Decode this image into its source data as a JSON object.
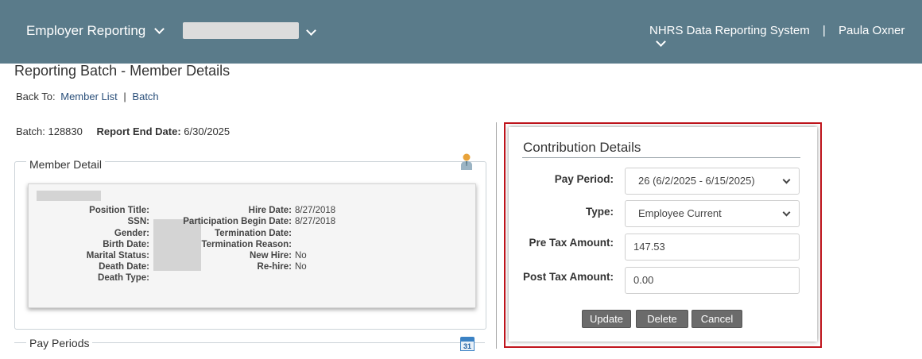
{
  "header": {
    "menu_label": "Employer Reporting",
    "system_name": "NHRS Data Reporting System",
    "separator": "|",
    "user_name": "Paula Oxner"
  },
  "page": {
    "title": "Reporting Batch - Member Details",
    "back_to_label": "Back To:",
    "back_links": [
      "Member List",
      "Batch"
    ],
    "back_separator": "|",
    "batch_label": "Batch:",
    "batch_value": "128830",
    "report_end_label": "Report End Date:",
    "report_end_value": "6/30/2025"
  },
  "member_detail": {
    "heading": "Member Detail",
    "left_fields": [
      {
        "label": "Position Title:",
        "value": ""
      },
      {
        "label": "SSN:",
        "value": ""
      },
      {
        "label": "Gender:",
        "value": ""
      },
      {
        "label": "Birth Date:",
        "value": ""
      },
      {
        "label": "Marital Status:",
        "value": ""
      },
      {
        "label": "Death Date:",
        "value": ""
      },
      {
        "label": "Death Type:",
        "value": ""
      }
    ],
    "right_fields": [
      {
        "label": "Hire Date:",
        "value": "8/27/2018"
      },
      {
        "label": "Participation Begin Date:",
        "value": "8/27/2018"
      },
      {
        "label": "Termination Date:",
        "value": ""
      },
      {
        "label": "Termination Reason:",
        "value": ""
      },
      {
        "label": "New Hire:",
        "value": "No"
      },
      {
        "label": "Re-hire:",
        "value": "No"
      }
    ]
  },
  "pay_periods": {
    "heading": "Pay Periods",
    "calendar_icon_text": "31"
  },
  "contribution": {
    "title": "Contribution Details",
    "pay_period_label": "Pay Period:",
    "pay_period_value": "26 (6/2/2025 - 6/15/2025)",
    "type_label": "Type:",
    "type_value": "Employee Current",
    "pre_tax_label": "Pre Tax Amount:",
    "pre_tax_value": "147.53",
    "post_tax_label": "Post Tax Amount:",
    "post_tax_value": "0.00",
    "update_label": "Update",
    "delete_label": "Delete",
    "cancel_label": "Cancel"
  },
  "colors": {
    "header_bg": "#5a7b8a",
    "highlight_border": "#c0141c",
    "button_bg": "#6b6b6b",
    "link": "#2a4f7a"
  },
  "icons": {
    "menu": "chevron-down-icon",
    "member": "person-icon",
    "pay_periods": "calendar-icon"
  }
}
